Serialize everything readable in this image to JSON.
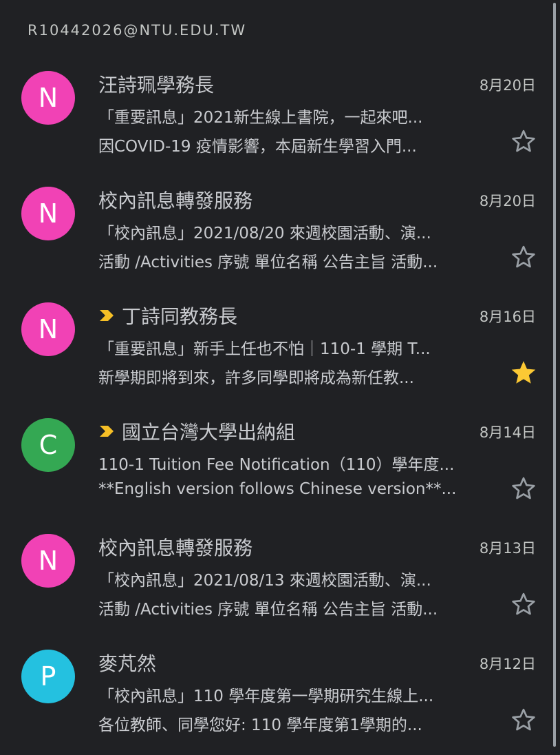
{
  "account": "R10442026@NTU.EDU.TW",
  "colors": {
    "important_marker": "#f6bf26",
    "star_filled": "#fcc934",
    "star_outline": "#9aa0a6"
  },
  "emails": [
    {
      "avatar_letter": "N",
      "avatar_color": "#f142b5",
      "important": false,
      "sender": "汪詩珮學務長",
      "date": "8月20日",
      "subject": "「重要訊息」2021新生線上書院，一起來吧...",
      "snippet": "因COVID-19 疫情影響，本屆新生學習入門...",
      "starred": false
    },
    {
      "avatar_letter": "N",
      "avatar_color": "#f142b5",
      "important": false,
      "sender": "校內訊息轉發服務",
      "date": "8月20日",
      "subject": "「校內訊息」2021/08/20 來週校園活動、演...",
      "snippet": "活動 /Activities 序號 單位名稱 公告主旨 活動...",
      "starred": false
    },
    {
      "avatar_letter": "N",
      "avatar_color": "#f142b5",
      "important": true,
      "sender": "丁詩同教務長",
      "date": "8月16日",
      "subject": "「重要訊息」新手上任也不怕｜110-1 學期 T...",
      "snippet": "新學期即將到來，許多同學即將成為新任教...",
      "starred": true
    },
    {
      "avatar_letter": "C",
      "avatar_color": "#34a853",
      "important": true,
      "sender": "國立台灣大學出納組",
      "date": "8月14日",
      "subject": "110-1 Tuition Fee Notification（110）學年度...",
      "snippet": "**English version follows Chinese version**...",
      "starred": false
    },
    {
      "avatar_letter": "N",
      "avatar_color": "#f142b5",
      "important": false,
      "sender": "校內訊息轉發服務",
      "date": "8月13日",
      "subject": "「校內訊息」2021/08/13 來週校園活動、演...",
      "snippet": "活動 /Activities 序號 單位名稱 公告主旨 活動...",
      "starred": false
    },
    {
      "avatar_letter": "P",
      "avatar_color": "#24c1e0",
      "important": false,
      "sender": "麥芃然",
      "date": "8月12日",
      "subject": "「校內訊息」110 學年度第一學期研究生線上...",
      "snippet": "各位教師、同學您好: 110 學年度第1學期的...",
      "starred": false
    }
  ]
}
